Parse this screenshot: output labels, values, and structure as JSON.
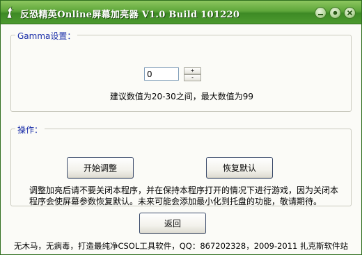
{
  "window": {
    "title": "反恐精英Online屏幕加亮器 V1.0 Build 101220",
    "controls": [
      "minimize",
      "maximize",
      "close"
    ]
  },
  "icons": {
    "app": "app-icon",
    "minimize": "minimize-icon",
    "maximize": "maximize-icon",
    "close": "close-icon"
  },
  "gamma": {
    "label": "Gamma设置：",
    "value": "0",
    "spin_up": "+",
    "spin_down": "-",
    "hint": "建议数值为20-30之间，最大数值为99"
  },
  "operation": {
    "label": "操作：",
    "start_button": "开始调整",
    "restore_button": "恢复默认",
    "note": "调整加亮后请不要关闭本程序，并在保持本程序打开的情况下进行游戏，因为关闭本程序会使屏幕参数恢复默认。未来可能会添加最小化到托盘的功能，敬请期待。"
  },
  "back_button": "返回",
  "footer": "无木马，无病毒，打造最纯净CSOL工具软件，QQ：867202328，2009-2011 扎克斯软件站",
  "colors": {
    "titlebar": "#5ea63a",
    "group_label": "#1a2ea8",
    "background": "#fbfbf7"
  }
}
